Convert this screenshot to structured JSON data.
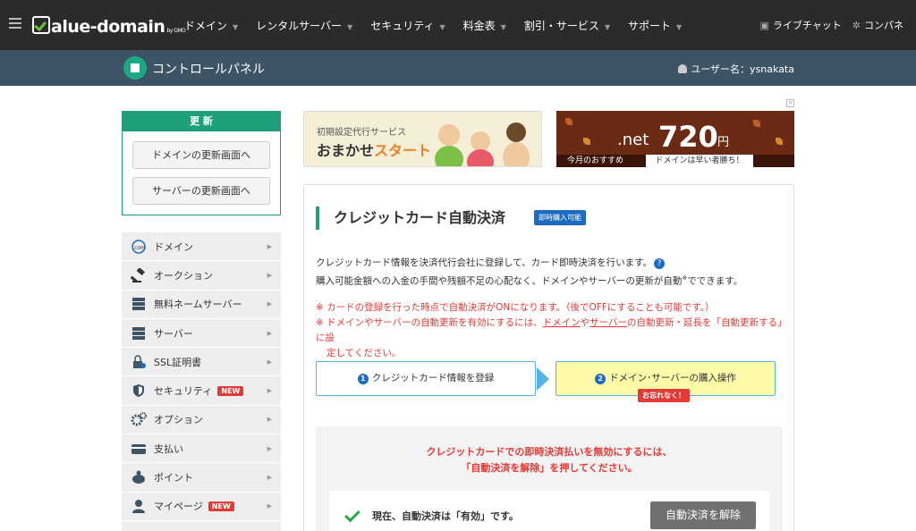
{
  "header": {
    "logo": "alue-domain",
    "logo_sub": "by GMO",
    "nav": [
      {
        "label": "ドメイン"
      },
      {
        "label": "レンタルサーバー"
      },
      {
        "label": "セキュリティ"
      },
      {
        "label": "料金表"
      },
      {
        "label": "割引・サービス"
      },
      {
        "label": "サポート"
      }
    ],
    "live_chat": "ライブチャット",
    "control_panel": "コンパネ"
  },
  "subbar": {
    "title": "コントロールパネル",
    "user": "ユーザー名：ysnakata"
  },
  "renew": {
    "title": "更 新",
    "domain_btn": "ドメインの更新画面へ",
    "server_btn": "サーバーの更新画面へ"
  },
  "sidebar": {
    "items": [
      {
        "label": "ドメイン",
        "icon": "com-globe-icon"
      },
      {
        "label": "オークション",
        "icon": "gavel-icon"
      },
      {
        "label": "無料ネームサーバー",
        "icon": "server-icon"
      },
      {
        "label": "サーバー",
        "icon": "server-icon"
      },
      {
        "label": "SSL証明書",
        "icon": "lock-icon"
      },
      {
        "label": "セキュリティ",
        "icon": "shield-icon",
        "badge": "NEW"
      },
      {
        "label": "オプション",
        "icon": "gears-icon"
      },
      {
        "label": "支払い",
        "icon": "card-icon"
      },
      {
        "label": "ポイント",
        "icon": "piggy-icon"
      },
      {
        "label": "マイページ",
        "icon": "person-icon",
        "badge": "NEW"
      }
    ]
  },
  "banners": {
    "left_small": "初期設定代行サービス",
    "left_big_a": "おまかせ",
    "left_big_b": "スタート",
    "right_net": ".net",
    "right_price": "720",
    "right_yen": "円",
    "right_bottom_left": "今月のおすすめ",
    "right_bottom_right": "ドメインは早い者勝ち！"
  },
  "main": {
    "title": "クレジットカード自動決済",
    "tag": "即時購入可能",
    "desc_line1": "クレジットカード情報を決済代行会社に登録して、カード即時決済を行います。",
    "desc_line2": "購入可能金額への入金の手間や残額不足の心配なく、ドメインやサーバーの更新が自動",
    "desc_line2_sup": "※",
    "desc_line2_end": "でできます。",
    "note1": "※ カードの登録を行った時点で自動決済がONになります。（後でOFFにすることも可能です。）",
    "note2_a": "※ ドメインやサーバーの自動更新を有効にするには、",
    "note2_link1": "ドメイン",
    "note2_b": "や",
    "note2_link2": "サーバー",
    "note2_c": "の自動更新・延長を「自動更新する」に設",
    "note2_d": "定してください。",
    "step1_num": "1",
    "step1": "クレジットカード情報を登録",
    "step2_num": "2",
    "step2": "ドメイン･サーバーの購入操作",
    "forget": "お忘れなく！",
    "gray_msg1": "クレジットカードでの即時決済払いを無効にするには、",
    "gray_msg2": "「自動決済を解除」を押してください。",
    "status": "現在、自動決済は「有効」です。",
    "cancel_btn": "自動決済を解除"
  }
}
